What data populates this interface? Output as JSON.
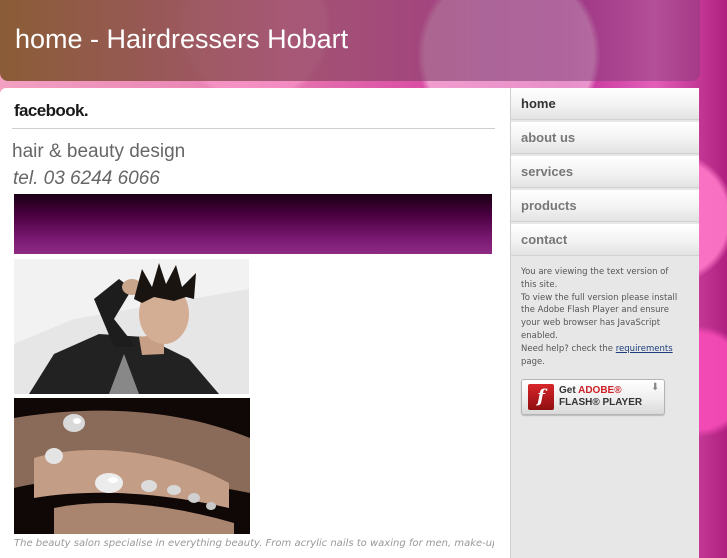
{
  "header": {
    "title": "home - Hairdressers Hobart"
  },
  "main": {
    "facebook_logo": "facebook.",
    "tagline": "hair & beauty design",
    "phone": "tel. 03 6244 6066",
    "body_text": "The beauty salon specialise in everything beauty. From acrylic nails to waxing for men, make-up"
  },
  "nav": {
    "items": [
      {
        "label": "home",
        "active": true
      },
      {
        "label": "about us"
      },
      {
        "label": "services"
      },
      {
        "label": "products"
      },
      {
        "label": "contact"
      }
    ]
  },
  "info": {
    "line1": "You are viewing the text version of this site.",
    "line2": "To view the full version please install the Adobe Flash Player and ensure your web browser has JavaScript enabled.",
    "line3_prefix": "Need help? check the",
    "line3_link": "requirements",
    "line3_suffix": "page."
  },
  "flash_badge": {
    "get": "Get",
    "brand": "ADOBE®",
    "product": "FLASH® PLAYER",
    "icon_glyph": "f"
  },
  "colors": {
    "background_accent": "#d94aa3",
    "banner": "#5a0850",
    "link": "#1a3d7a"
  }
}
